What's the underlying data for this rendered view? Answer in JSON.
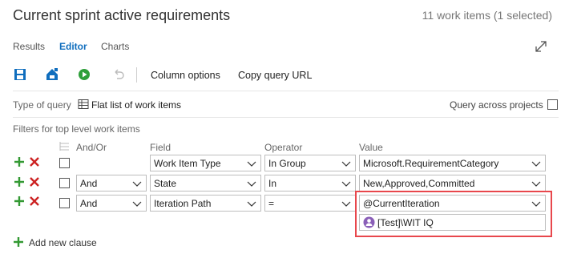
{
  "header": {
    "title": "Current sprint active requirements",
    "count": "11 work items (1 selected)"
  },
  "tabs": [
    "Results",
    "Editor",
    "Charts"
  ],
  "active_tab": "Editor",
  "toolbar": {
    "column_options": "Column options",
    "copy_query_url": "Copy query URL"
  },
  "query_type": {
    "label": "Type of query",
    "value": "Flat list of work items",
    "across_projects": "Query across projects"
  },
  "filters": {
    "section_label": "Filters for top level work items",
    "headers": {
      "and_or": "And/Or",
      "field": "Field",
      "operator": "Operator",
      "value": "Value"
    },
    "rows": [
      {
        "and_or": "",
        "field": "Work Item Type",
        "operator": "In Group",
        "value": "Microsoft.RequirementCategory"
      },
      {
        "and_or": "And",
        "field": "State",
        "operator": "In",
        "value": "New,Approved,Committed"
      },
      {
        "and_or": "And",
        "field": "Iteration Path",
        "operator": "=",
        "value": "@CurrentIteration",
        "team": "[Test]\\WIT IQ"
      }
    ],
    "add_clause": "Add new clause"
  },
  "colors": {
    "accent": "#106ebe",
    "add_green": "#339933",
    "remove_red": "#cc2222",
    "run_green": "#2e9f3a",
    "highlight_red": "#e8474c"
  },
  "icons": [
    "save-icon",
    "save-as-icon",
    "run-icon",
    "undo-icon",
    "expand-icon",
    "list-icon",
    "add-icon",
    "remove-icon",
    "chevron-down-icon",
    "team-icon",
    "group-rows-icon"
  ]
}
